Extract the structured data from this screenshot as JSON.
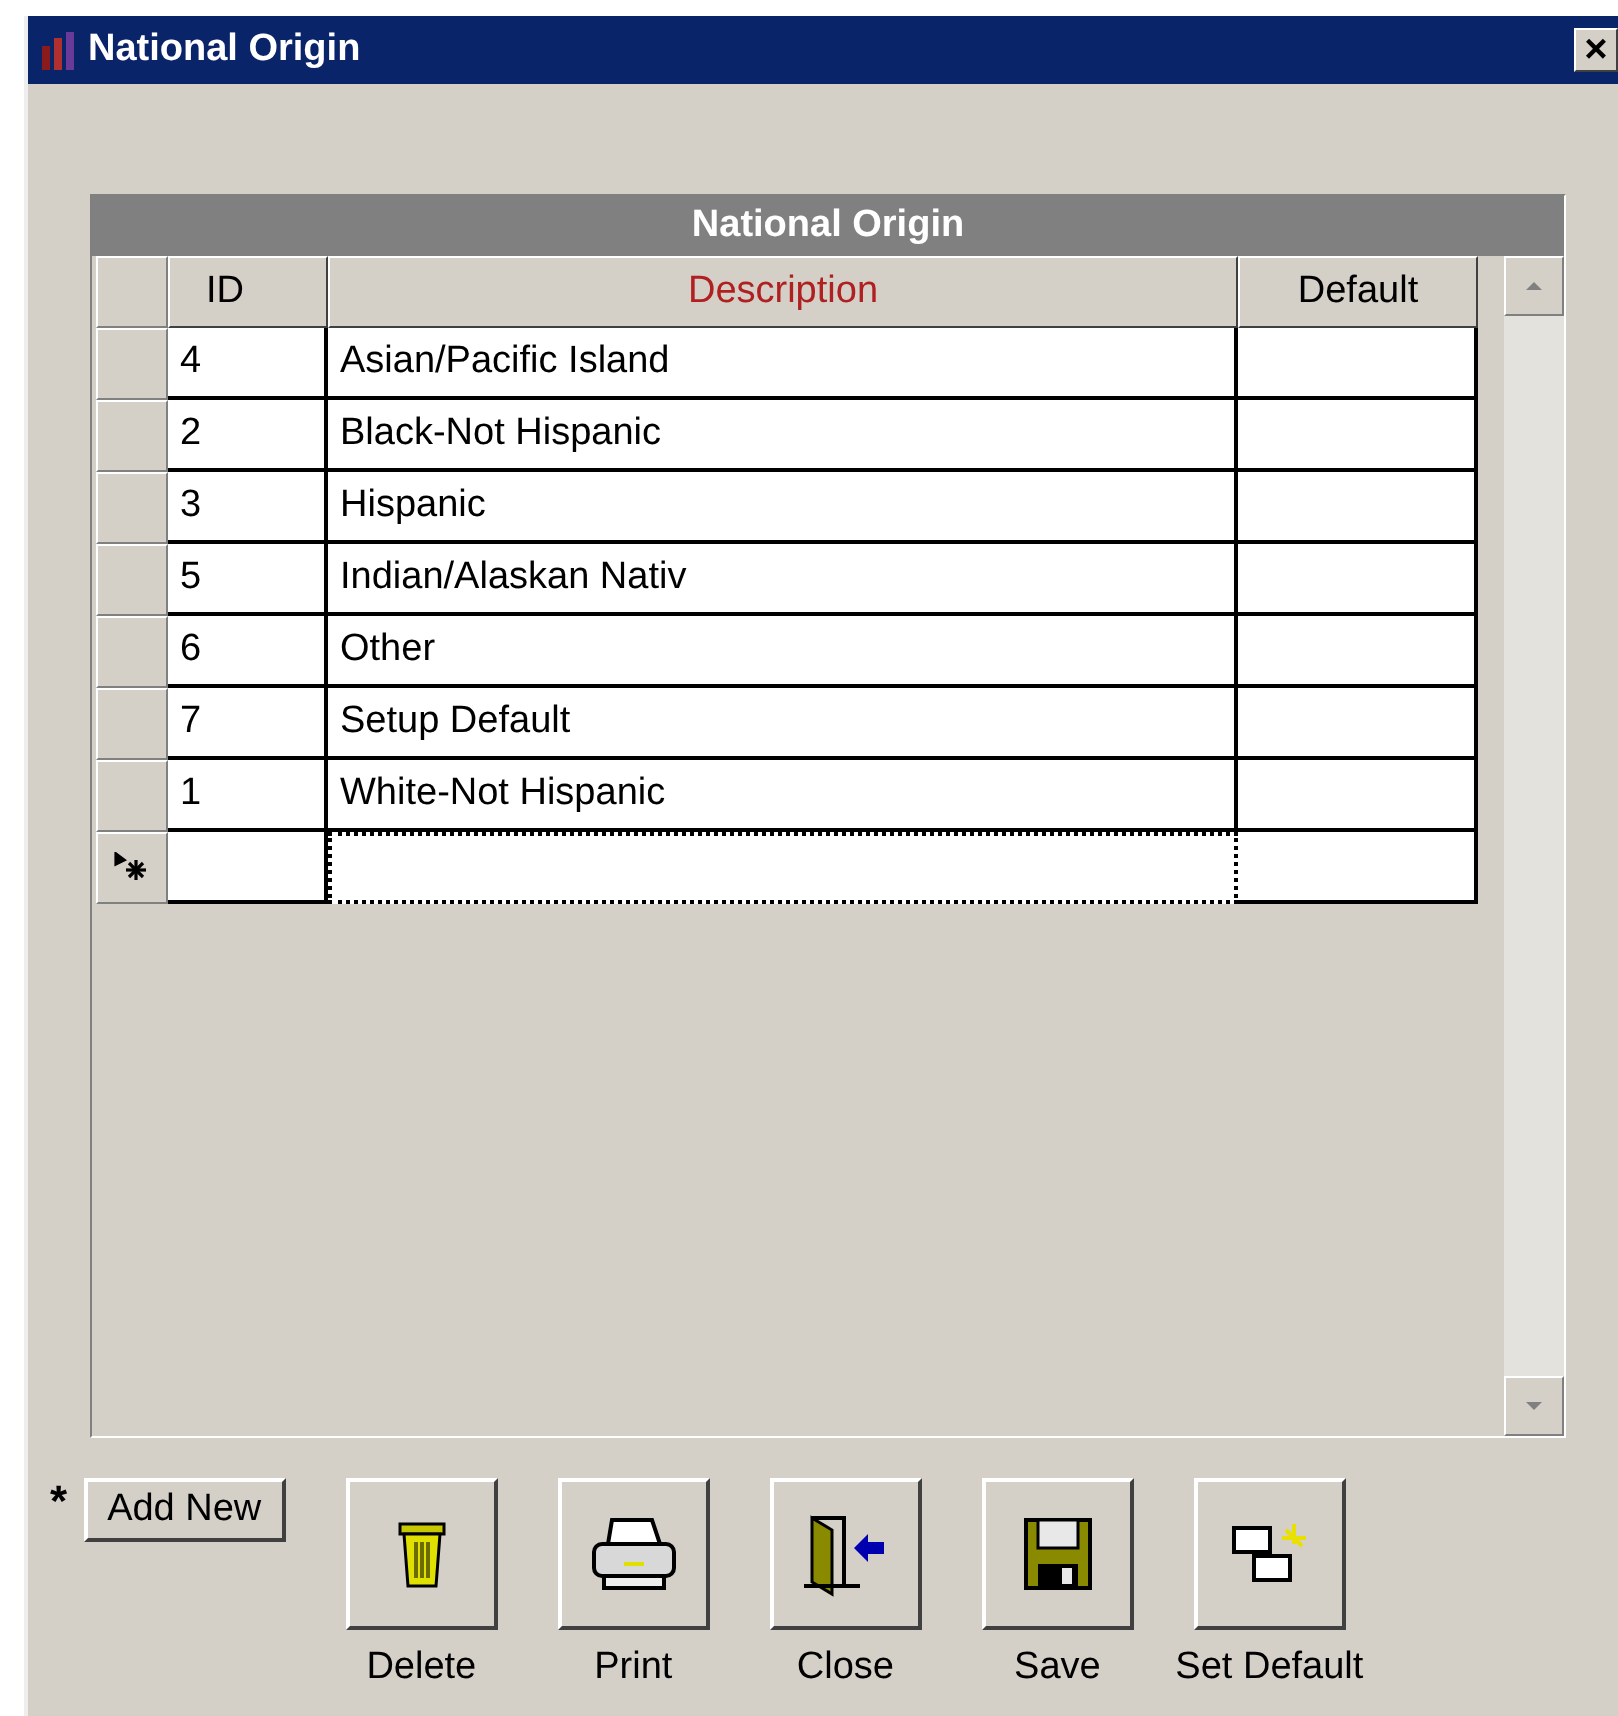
{
  "window": {
    "title": "National Origin",
    "close": "×"
  },
  "grid": {
    "caption": "National Origin",
    "columns": [
      {
        "label": "ID",
        "kind": "plain"
      },
      {
        "label": "Description",
        "kind": "required"
      },
      {
        "label": "Default",
        "kind": "plain"
      }
    ],
    "rows": [
      {
        "id": "4",
        "description": "Asian/Pacific Island"
      },
      {
        "id": "2",
        "description": "Black-Not Hispanic"
      },
      {
        "id": "3",
        "description": "Hispanic"
      },
      {
        "id": "5",
        "description": "Indian/Alaskan Nativ"
      },
      {
        "id": "6",
        "description": "Other"
      },
      {
        "id": "7",
        "description": "Setup Default"
      },
      {
        "id": "1",
        "description": "White-Not Hispanic"
      }
    ]
  },
  "add_new": {
    "marker": "*",
    "label": "Add New"
  },
  "buttons": [
    {
      "label": "Delete",
      "kind": "trash"
    },
    {
      "label": "Print",
      "kind": "printer"
    },
    {
      "label": "Close",
      "kind": "door"
    },
    {
      "label": "Save",
      "kind": "disk"
    },
    {
      "label": "Set Default",
      "kind": "windows"
    }
  ]
}
